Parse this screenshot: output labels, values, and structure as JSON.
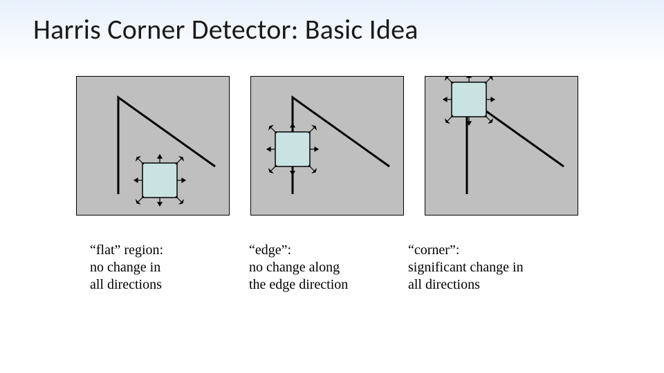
{
  "title": "Harris Corner Detector: Basic Idea",
  "captions": {
    "flat": {
      "label": "“flat” region:",
      "line2": "no change in",
      "line3": "all directions"
    },
    "edge": {
      "label": "“edge”:",
      "line2": "no change along",
      "line3": "the edge direction"
    },
    "corner": {
      "label": "“corner”:",
      "line2": "significant change in",
      "line3": "all directions"
    }
  },
  "panels": {
    "flat": {
      "window_pos": "lower-middle"
    },
    "edge": {
      "window_pos": "on-edge"
    },
    "corner": {
      "window_pos": "on-corner"
    }
  },
  "colors": {
    "panel_bg": "#bfbfbf",
    "window_fill": "#c9e2e2",
    "stroke": "#000000"
  }
}
